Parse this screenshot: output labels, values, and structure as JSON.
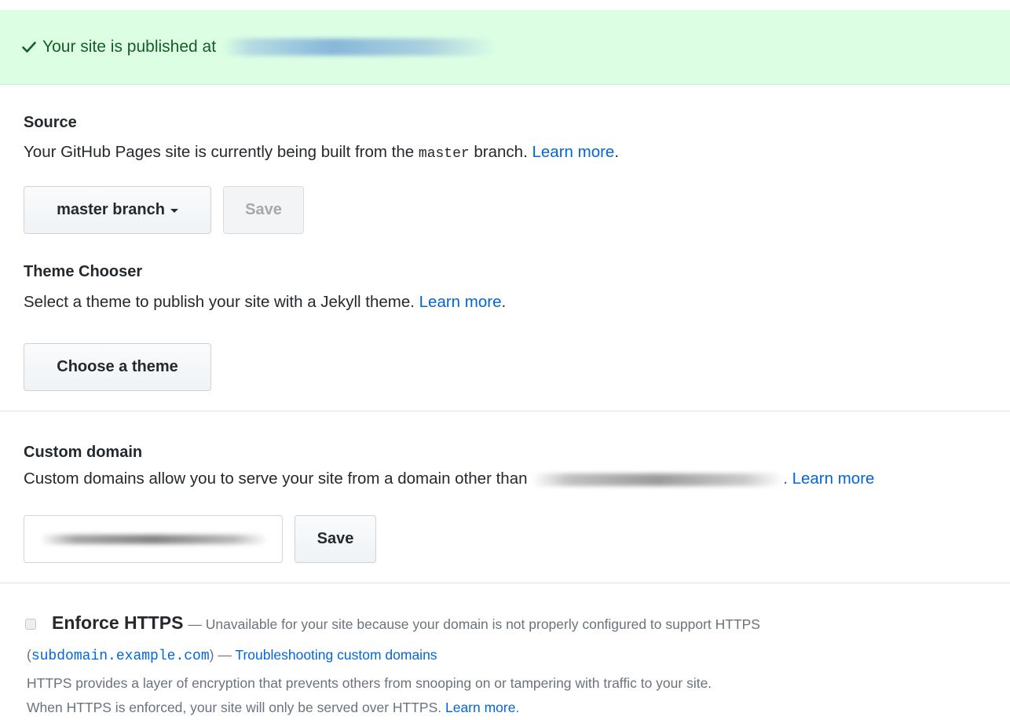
{
  "flash": {
    "message": "Your site is published at",
    "icon": "check-icon",
    "color": "#165c26",
    "background": "#dcffe4"
  },
  "source": {
    "heading": "Source",
    "desc_prefix": "Your GitHub Pages site is currently being built from the",
    "branch_code": "master",
    "desc_suffix": "branch.",
    "learn_more": "Learn more",
    "period": ".",
    "dropdown_label": "master branch",
    "save_label": "Save"
  },
  "theme": {
    "heading": "Theme Chooser",
    "desc": "Select a theme to publish your site with a Jekyll theme.",
    "learn_more": "Learn more",
    "period": ".",
    "button_label": "Choose a theme"
  },
  "custom_domain": {
    "heading": "Custom domain",
    "desc_prefix": "Custom domains allow you to serve your site from a domain other than",
    "learn_more": ". Learn more",
    "save_label": "Save"
  },
  "https": {
    "title": "Enforce HTTPS",
    "unavailable_text": "— Unavailable for your site because your domain is not properly configured to support HTTPS",
    "paren_open": "(",
    "domain_code": "subdomain.example.com",
    "paren_close": ") —",
    "troubleshoot_link": "Troubleshooting custom domains",
    "info_line1": "HTTPS provides a layer of encryption that prevents others from snooping on or tampering with traffic to your site.",
    "info_line2": "When HTTPS is enforced, your site will only be served over HTTPS.",
    "learn_more": "Learn more",
    "period": "."
  },
  "colors": {
    "link": "#0366d6",
    "text": "#24292e",
    "muted": "#6a737d"
  }
}
